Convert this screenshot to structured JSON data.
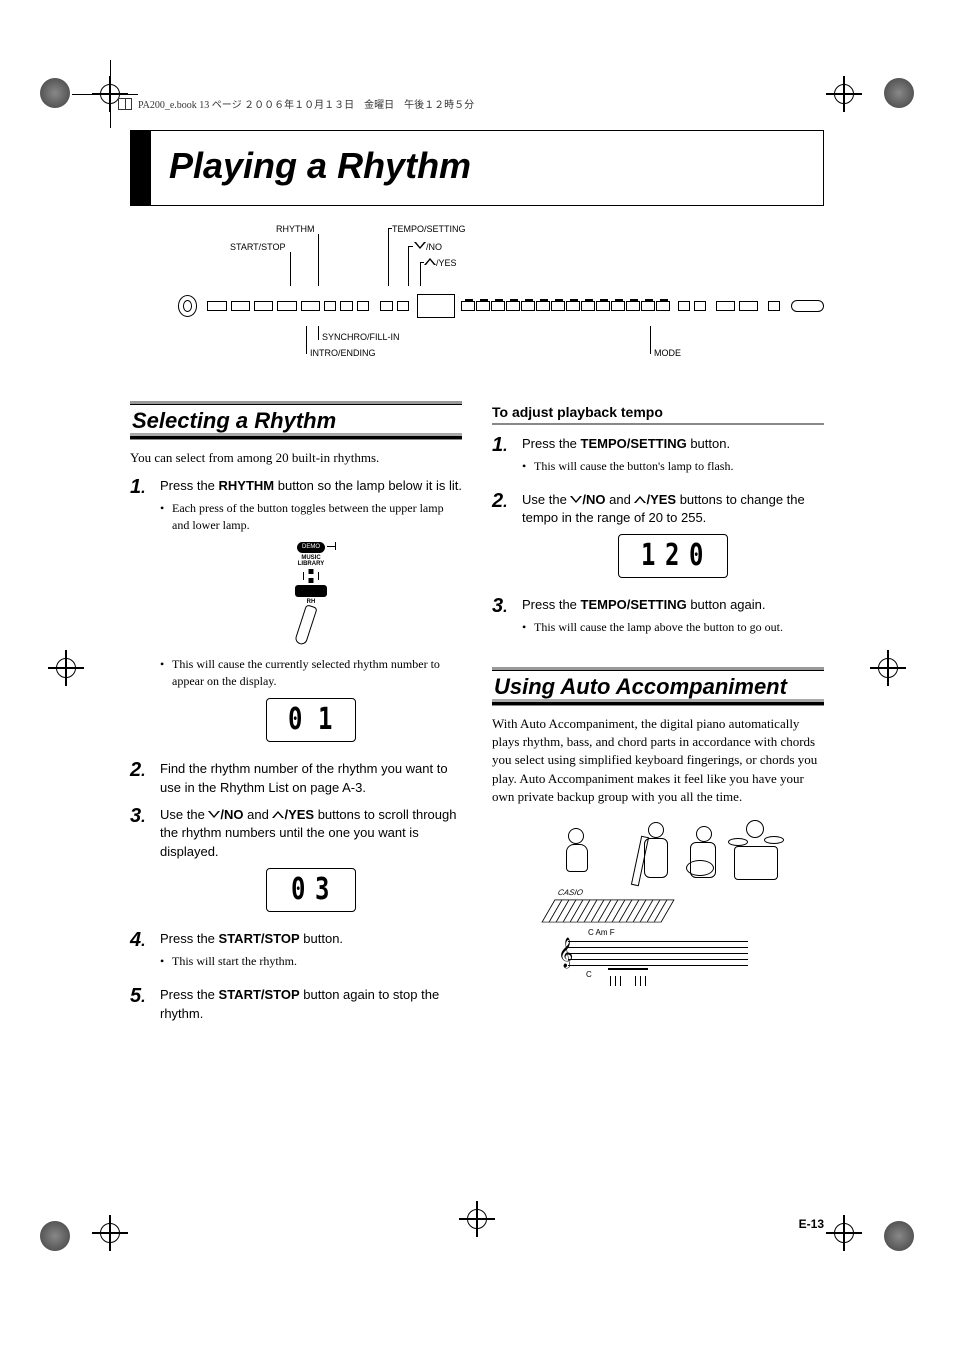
{
  "header_meta": "PA200_e.book  13 ページ  ２００６年１０月１３日　金曜日　午後１２時５分",
  "page_title": "Playing a Rhythm",
  "panel_labels": {
    "rhythm": "RHYTHM",
    "tempo_setting": "TEMPO/SETTING",
    "start_stop": "START/STOP",
    "no": "/NO",
    "yes": "/YES",
    "synchro": "SYNCHRO/FILL-IN",
    "intro": "INTRO/ENDING",
    "mode": "MODE"
  },
  "left": {
    "section1_title": "Selecting a Rhythm",
    "intro": "You can select from among 20 built-in rhythms.",
    "step1": {
      "pre": "Press the ",
      "btn": "RHYTHM",
      "post": " button so the lamp below it is lit."
    },
    "step1_bullets": [
      "Each press of the button toggles between the upper lamp and lower lamp.",
      "This will cause the currently selected rhythm number to appear on the display."
    ],
    "fig_button": {
      "demo": "DEMO",
      "music": "MUSIC",
      "library": "LIBRARY",
      "rh": "RH"
    },
    "display1_value": "01",
    "step2": "Find the rhythm number of the rhythm you want to use in the Rhythm List on page A-3.",
    "step3": {
      "pre": "Use the ",
      "no": "/NO",
      "and": " and ",
      "yes": "/YES",
      "post": " buttons to scroll through the rhythm numbers until the one you want is displayed."
    },
    "display2_value": "03",
    "step4": {
      "pre": "Press the ",
      "btn": "START/STOP",
      "post": " button."
    },
    "step4_bullet": "This will start the rhythm.",
    "step5": {
      "pre": "Press the ",
      "btn": "START/STOP",
      "post": " button again to stop the rhythm."
    }
  },
  "right": {
    "sub_head": "To adjust playback tempo",
    "t_step1": {
      "pre": "Press the ",
      "btn": "TEMPO/SETTING",
      "post": " button."
    },
    "t_step1_bullet": "This will cause the button's lamp to flash.",
    "t_step2": {
      "pre": "Use the ",
      "no": "/NO",
      "and": " and ",
      "yes": "/YES",
      "post": " buttons to change the tempo in the range of 20 to 255."
    },
    "display_tempo_value": "120",
    "t_step3": {
      "pre": "Press the ",
      "btn": "TEMPO/SETTING",
      "post": " button again."
    },
    "t_step3_bullet": "This will cause the lamp above the button to go out.",
    "section2_title": "Using Auto Accompaniment",
    "auto_body": "With Auto Accompaniment, the digital piano automatically plays rhythm, bass, and chord parts in accordance with chords you select using simplified keyboard fingerings, or chords you play. Auto Accompaniment makes it feel like you have your own private backup group with you all the time.",
    "illus": {
      "brand": "CASIO",
      "chords_line": "C    Am   F",
      "tab_c": "C"
    }
  },
  "page_number": "E-13"
}
